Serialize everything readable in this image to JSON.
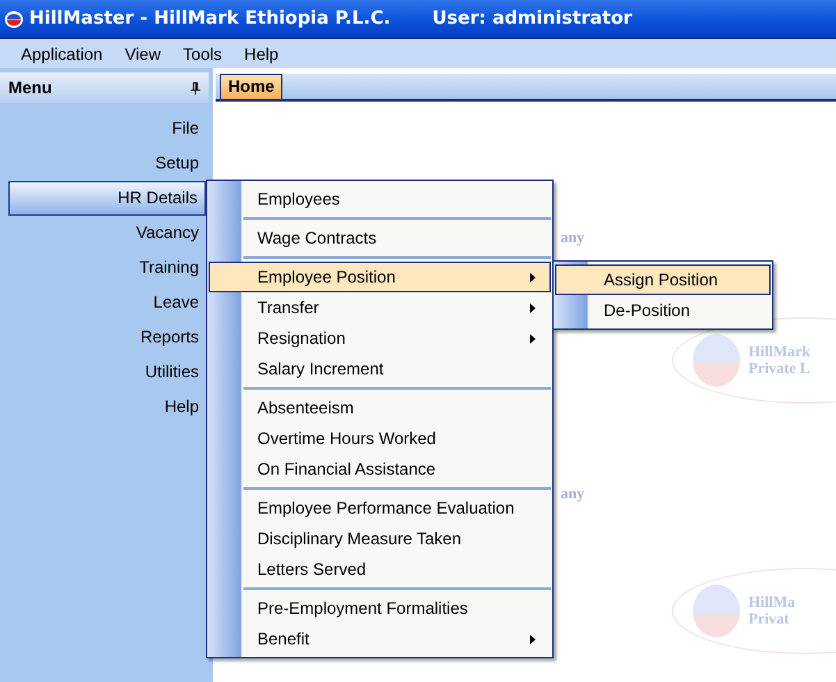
{
  "window": {
    "title": "HillMaster - HillMark Ethiopia P.L.C.",
    "user": "User: administrator"
  },
  "menubar": [
    "Application",
    "View",
    "Tools",
    "Help"
  ],
  "sidebar": {
    "title": "Menu",
    "items": [
      {
        "label": "File",
        "selected": false
      },
      {
        "label": "Setup",
        "selected": false
      },
      {
        "label": "HR Details",
        "selected": true
      },
      {
        "label": "Vacancy",
        "selected": false
      },
      {
        "label": "Training",
        "selected": false
      },
      {
        "label": "Leave",
        "selected": false
      },
      {
        "label": "Reports",
        "selected": false
      },
      {
        "label": "Utilities",
        "selected": false
      },
      {
        "label": "Help",
        "selected": false
      }
    ]
  },
  "tabs": [
    {
      "label": "Home",
      "selected": true
    }
  ],
  "background_logos": [
    {
      "lines": [
        "HillMark",
        "Private L"
      ]
    },
    {
      "lines": [
        "HillMa",
        "Privat"
      ]
    }
  ],
  "background_fragments": [
    "any",
    "any"
  ],
  "popup_menu": [
    {
      "kind": "item",
      "label": "Employees",
      "submenu": false,
      "selected": false
    },
    {
      "kind": "separator"
    },
    {
      "kind": "item",
      "label": "Wage Contracts",
      "submenu": false,
      "selected": false
    },
    {
      "kind": "separator"
    },
    {
      "kind": "item",
      "label": "Employee Position",
      "submenu": true,
      "selected": true
    },
    {
      "kind": "item",
      "label": "Transfer",
      "submenu": true,
      "selected": false
    },
    {
      "kind": "item",
      "label": "Resignation",
      "submenu": true,
      "selected": false
    },
    {
      "kind": "item",
      "label": "Salary Increment",
      "submenu": false,
      "selected": false
    },
    {
      "kind": "separator"
    },
    {
      "kind": "item",
      "label": "Absenteeism",
      "submenu": false,
      "selected": false
    },
    {
      "kind": "item",
      "label": "Overtime Hours Worked",
      "submenu": false,
      "selected": false
    },
    {
      "kind": "item",
      "label": "On Financial Assistance",
      "submenu": false,
      "selected": false
    },
    {
      "kind": "separator"
    },
    {
      "kind": "item",
      "label": "Employee Performance Evaluation",
      "submenu": false,
      "selected": false
    },
    {
      "kind": "item",
      "label": "Disciplinary Measure Taken",
      "submenu": false,
      "selected": false
    },
    {
      "kind": "item",
      "label": "Letters Served",
      "submenu": false,
      "selected": false
    },
    {
      "kind": "separator"
    },
    {
      "kind": "item",
      "label": "Pre-Employment Formalities",
      "submenu": false,
      "selected": false
    },
    {
      "kind": "item",
      "label": "Benefit",
      "submenu": true,
      "selected": false
    }
  ],
  "submenu": [
    {
      "label": "Assign Position",
      "selected": true
    },
    {
      "label": "De-Position",
      "selected": false
    }
  ]
}
